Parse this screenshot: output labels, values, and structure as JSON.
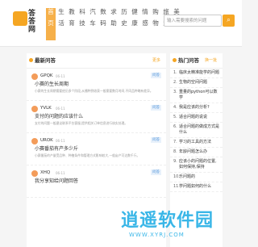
{
  "logo": {
    "text": "答答网"
  },
  "nav": [
    {
      "l1": "首",
      "l2": "页",
      "active": true
    },
    {
      "l1": "生",
      "l2": "活"
    },
    {
      "l1": "教",
      "l2": "育"
    },
    {
      "l1": "科",
      "l2": "技"
    },
    {
      "l1": "汽",
      "l2": "车"
    },
    {
      "l1": "数",
      "l2": "码"
    },
    {
      "l1": "求",
      "l2": "助"
    },
    {
      "l1": "历",
      "l2": "史"
    },
    {
      "l1": "健",
      "l2": "康"
    },
    {
      "l1": "情",
      "l2": "感"
    },
    {
      "l1": "购",
      "l2": "物"
    },
    {
      "l1": "旅",
      "l2": "游"
    },
    {
      "l1": "美",
      "l2": "食"
    }
  ],
  "search": {
    "placeholder": "输入需要搜索的问题"
  },
  "left": {
    "title": "最新问答",
    "more": "更多",
    "questions": [
      {
        "user": "GPQK",
        "date": "06-11",
        "tag": "问答",
        "title": "小赛的生长周期",
        "desc": "小赛的生长周期需要经历多个阶段,从播种到收获一般需要数月时间,不同品种略有差异。"
      },
      {
        "user": "YVLK",
        "date": "06-11",
        "tag": "问答",
        "title": "支付的问题的应该什么",
        "desc": "支付的问题一般建议联系平台客服,提供相关订单信息进行核实处理。"
      },
      {
        "user": "UROK",
        "date": "06-11",
        "tag": "问答",
        "title": "小赛番茄有产多少斤",
        "desc": "小赛番茄的产量受品种、种植条件和管理方式影响较大,一般亩产可达数千斤。"
      },
      {
        "user": "XHQ",
        "date": "06-11",
        "tag": "问答",
        "title": "我分享知给问题回答",
        "desc": ""
      }
    ]
  },
  "right": {
    "title": "热门问答",
    "more": "换一批",
    "items": [
      "临床太精准能学的问题",
      "生物的空间问题",
      "重量的python可以数学",
      "我是应该的分析?",
      "适合问题的说说",
      "适合问题的做成方式是什么",
      "学习的工具的方法",
      "年龄问题怎么办",
      "应该小的问题的位置,如何保持,保持",
      "乐问题的",
      "学问题如何的什么"
    ]
  },
  "watermark": {
    "main": "逍遥软件园",
    "sub": "WWW.XYRJ.COM"
  },
  "colors": {
    "accent": "#f5a623",
    "tag": "#4a90d9",
    "watermark": "#29b0e6"
  }
}
